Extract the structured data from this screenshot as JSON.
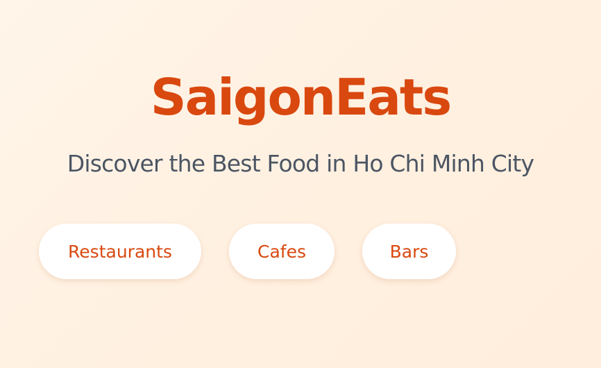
{
  "app": {
    "title": "SaigonEats",
    "tagline": "Discover the Best Food in Ho Chi Minh City"
  },
  "categories": [
    {
      "label": "Restaurants"
    },
    {
      "label": "Cafes"
    },
    {
      "label": "Bars"
    }
  ],
  "colors": {
    "accent": "#d9480f",
    "text_muted": "#4b5563",
    "chip_background": "#ffffff",
    "page_background": "#fff3e6"
  }
}
